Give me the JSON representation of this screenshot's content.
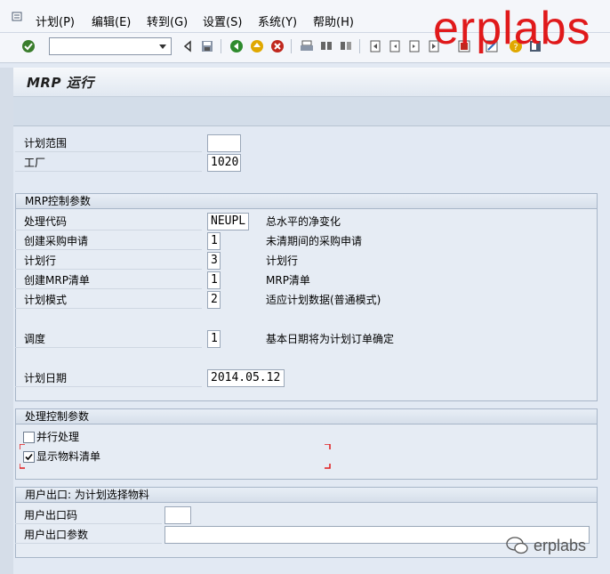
{
  "menu": {
    "items": [
      {
        "label": "计划(P)"
      },
      {
        "label": "编辑(E)"
      },
      {
        "label": "转到(G)"
      },
      {
        "label": "设置(S)"
      },
      {
        "label": "系统(Y)"
      },
      {
        "label": "帮助(H)"
      }
    ]
  },
  "toolbar": {
    "command_value": ""
  },
  "title": "MRP 运行",
  "fields": {
    "plan_scope": {
      "label": "计划范围",
      "value": ""
    },
    "plant": {
      "label": "工厂",
      "value": "1020"
    }
  },
  "mrp_control": {
    "heading": "MRP控制参数",
    "processing_key": {
      "label": "处理代码",
      "value": "NEUPL",
      "desc": "总水平的净变化"
    },
    "create_purreq": {
      "label": "创建采购申请",
      "value": "1",
      "desc": "未清期间的采购申请"
    },
    "schedule_lines": {
      "label": "计划行",
      "value": "3",
      "desc": "计划行"
    },
    "create_mrp_list": {
      "label": "创建MRP清单",
      "value": "1",
      "desc": "MRP清单"
    },
    "planning_mode": {
      "label": "计划模式",
      "value": "2",
      "desc": "适应计划数据(普通模式)"
    },
    "scheduling": {
      "label": "调度",
      "value": "1",
      "desc": "基本日期将为计划订单确定"
    },
    "planning_date": {
      "label": "计划日期",
      "value": "2014.05.12"
    }
  },
  "proc_control": {
    "heading": "处理控制参数",
    "parallel": {
      "label": "并行处理",
      "checked": false
    },
    "display_material_list": {
      "label": "显示物料清单",
      "checked": true
    }
  },
  "user_exit": {
    "heading": "用户出口: 为计划选择物料",
    "exit_key": {
      "label": "用户出口码",
      "value": ""
    },
    "exit_param": {
      "label": "用户出口参数",
      "value": ""
    }
  },
  "watermark": {
    "big": "erplabs",
    "small": "erplabs"
  },
  "colors": {
    "accent": "#e0191b",
    "background": "#e2e9f3"
  }
}
